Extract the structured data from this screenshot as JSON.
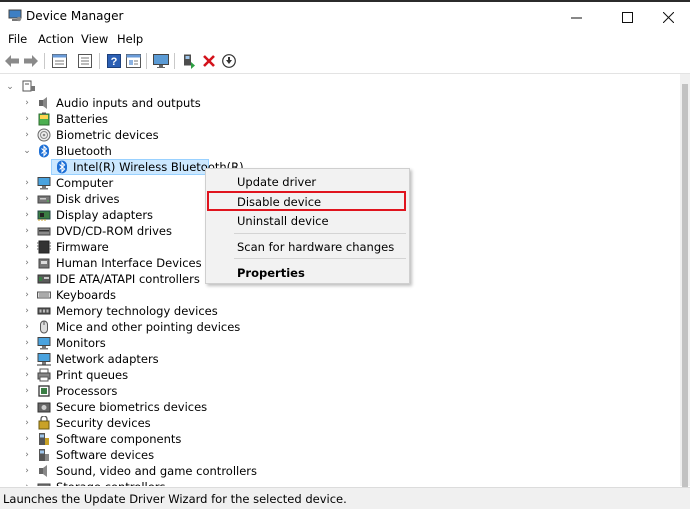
{
  "window": {
    "title": "Device Manager",
    "min_icon": "minimize-icon",
    "max_icon": "maximize-icon",
    "close_icon": "close-icon"
  },
  "menu": [
    "File",
    "Action",
    "View",
    "Help"
  ],
  "toolbar": [
    "back-arrow-icon",
    "forward-arrow-icon",
    "properties-icon",
    "show-hide-icon",
    "help-icon",
    "details-icon",
    "monitor-scan-icon",
    "update-driver-icon",
    "uninstall-x-icon",
    "disable-down-arrow-icon"
  ],
  "tree": {
    "root_icon": "computer-icon",
    "items": [
      {
        "label": "Audio inputs and outputs",
        "expander": "›",
        "icon": "speaker-icon"
      },
      {
        "label": "Batteries",
        "expander": "›",
        "icon": "battery-icon"
      },
      {
        "label": "Biometric devices",
        "expander": "›",
        "icon": "fingerprint-icon"
      },
      {
        "label": "Bluetooth",
        "expander": "⌄",
        "icon": "bluetooth-icon"
      },
      {
        "label": "Intel(R) Wireless Bluetooth(R)",
        "expander": "",
        "icon": "bluetooth-icon",
        "child": true,
        "selected": true
      },
      {
        "label": "Computer",
        "expander": "›",
        "icon": "computer-monitor-icon"
      },
      {
        "label": "Disk drives",
        "expander": "›",
        "icon": "disk-drive-icon"
      },
      {
        "label": "Display adapters",
        "expander": "›",
        "icon": "display-adapter-icon"
      },
      {
        "label": "DVD/CD-ROM drives",
        "expander": "›",
        "icon": "dvd-icon"
      },
      {
        "label": "Firmware",
        "expander": "›",
        "icon": "firmware-icon"
      },
      {
        "label": "Human Interface Devices",
        "expander": "›",
        "icon": "hid-icon"
      },
      {
        "label": "IDE ATA/ATAPI controllers",
        "expander": "›",
        "icon": "ide-controller-icon"
      },
      {
        "label": "Keyboards",
        "expander": "›",
        "icon": "keyboard-icon"
      },
      {
        "label": "Memory technology devices",
        "expander": "›",
        "icon": "memory-icon"
      },
      {
        "label": "Mice and other pointing devices",
        "expander": "›",
        "icon": "mouse-icon"
      },
      {
        "label": "Monitors",
        "expander": "›",
        "icon": "monitor-icon"
      },
      {
        "label": "Network adapters",
        "expander": "›",
        "icon": "network-icon"
      },
      {
        "label": "Print queues",
        "expander": "›",
        "icon": "printer-icon"
      },
      {
        "label": "Processors",
        "expander": "›",
        "icon": "processor-icon"
      },
      {
        "label": "Secure biometrics devices",
        "expander": "›",
        "icon": "secure-biometric-icon"
      },
      {
        "label": "Security devices",
        "expander": "›",
        "icon": "security-icon"
      },
      {
        "label": "Software components",
        "expander": "›",
        "icon": "software-component-icon"
      },
      {
        "label": "Software devices",
        "expander": "›",
        "icon": "software-device-icon"
      },
      {
        "label": "Sound, video and game controllers",
        "expander": "›",
        "icon": "sound-icon"
      },
      {
        "label": "Storage controllers",
        "expander": "›",
        "icon": "storage-icon"
      }
    ]
  },
  "context_menu": {
    "update_driver": "Update driver",
    "disable_device": "Disable device",
    "uninstall_device": "Uninstall device",
    "scan": "Scan for hardware changes",
    "properties": "Properties",
    "highlight_color": "#e0141e"
  },
  "status_text": "Launches the Update Driver Wizard for the selected device."
}
